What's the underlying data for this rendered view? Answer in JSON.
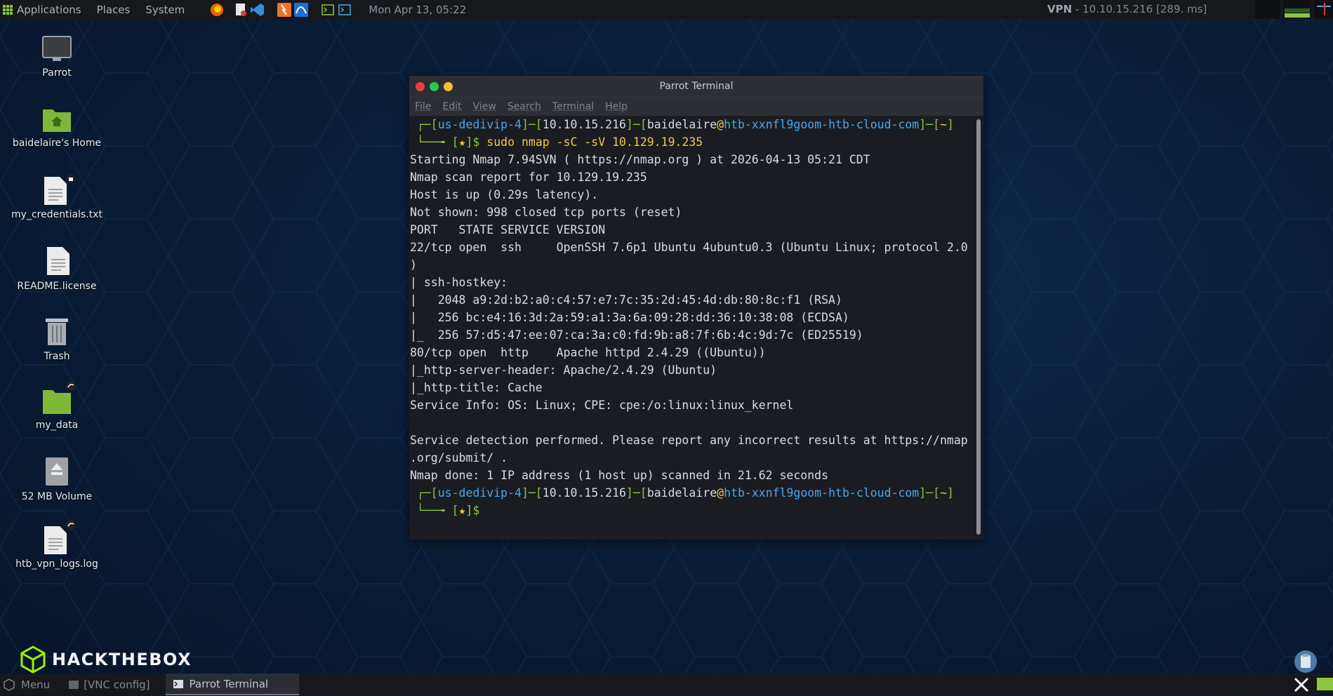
{
  "top_panel": {
    "menus": [
      "Applications",
      "Places",
      "System"
    ],
    "clock": "Mon Apr 13, 05:22",
    "vpn_label": "VPN",
    "vpn_detail": " - 10.10.15.216 [289. ms]"
  },
  "desktop_icons": [
    {
      "label": "Parrot",
      "icon": "monitor-icon"
    },
    {
      "label": "baidelaire's Home",
      "icon": "home-folder-icon"
    },
    {
      "label": "my_credentials.txt",
      "icon": "text-file-icon"
    },
    {
      "label": "README.license",
      "icon": "text-file-icon"
    },
    {
      "label": "Trash",
      "icon": "trash-icon"
    },
    {
      "label": "my_data",
      "icon": "folder-icon"
    },
    {
      "label": "52 MB Volume",
      "icon": "drive-icon"
    },
    {
      "label": "htb_vpn_logs.log",
      "icon": "text-file-icon"
    }
  ],
  "terminal": {
    "title": "Parrot Terminal",
    "menu": [
      "File",
      "Edit",
      "View",
      "Search",
      "Terminal",
      "Help"
    ],
    "prompt": {
      "host_a": "us-dedivip-4",
      "ip": "10.10.15.216",
      "user": "baidelaire",
      "host_b": "htb-xxnfl9goom-htb-cloud-com",
      "dir": "~",
      "star": "★",
      "command": "sudo nmap -sC -sV 10.129.19.235"
    },
    "output": [
      "Starting Nmap 7.94SVN ( https://nmap.org ) at 2026-04-13 05:21 CDT",
      "Nmap scan report for 10.129.19.235",
      "Host is up (0.29s latency).",
      "Not shown: 998 closed tcp ports (reset)",
      "PORT   STATE SERVICE VERSION",
      "22/tcp open  ssh     OpenSSH 7.6p1 Ubuntu 4ubuntu0.3 (Ubuntu Linux; protocol 2.0",
      ")",
      "| ssh-hostkey:",
      "|   2048 a9:2d:b2:a0:c4:57:e7:7c:35:2d:45:4d:db:80:8c:f1 (RSA)",
      "|   256 bc:e4:16:3d:2a:59:a1:3a:6a:09:28:dd:36:10:38:08 (ECDSA)",
      "|_  256 57:d5:47:ee:07:ca:3a:c0:fd:9b:a8:7f:6b:4c:9d:7c (ED25519)",
      "80/tcp open  http    Apache httpd 2.4.29 ((Ubuntu))",
      "|_http-server-header: Apache/2.4.29 (Ubuntu)",
      "|_http-title: Cache",
      "Service Info: OS: Linux; CPE: cpe:/o:linux:linux_kernel",
      "",
      "Service detection performed. Please report any incorrect results at https://nmap",
      ".org/submit/ .",
      "Nmap done: 1 IP address (1 host up) scanned in 21.62 seconds"
    ]
  },
  "branding": {
    "logo_text": "HACKTHEBOX"
  },
  "bottom_panel": {
    "menu_label": "Menu",
    "tasks": [
      "[VNC config]",
      "Parrot Terminal"
    ]
  },
  "colors": {
    "accent_green": "#8dc63f",
    "prompt_blue": "#4aa8e8",
    "star_yellow": "#f2c744"
  }
}
